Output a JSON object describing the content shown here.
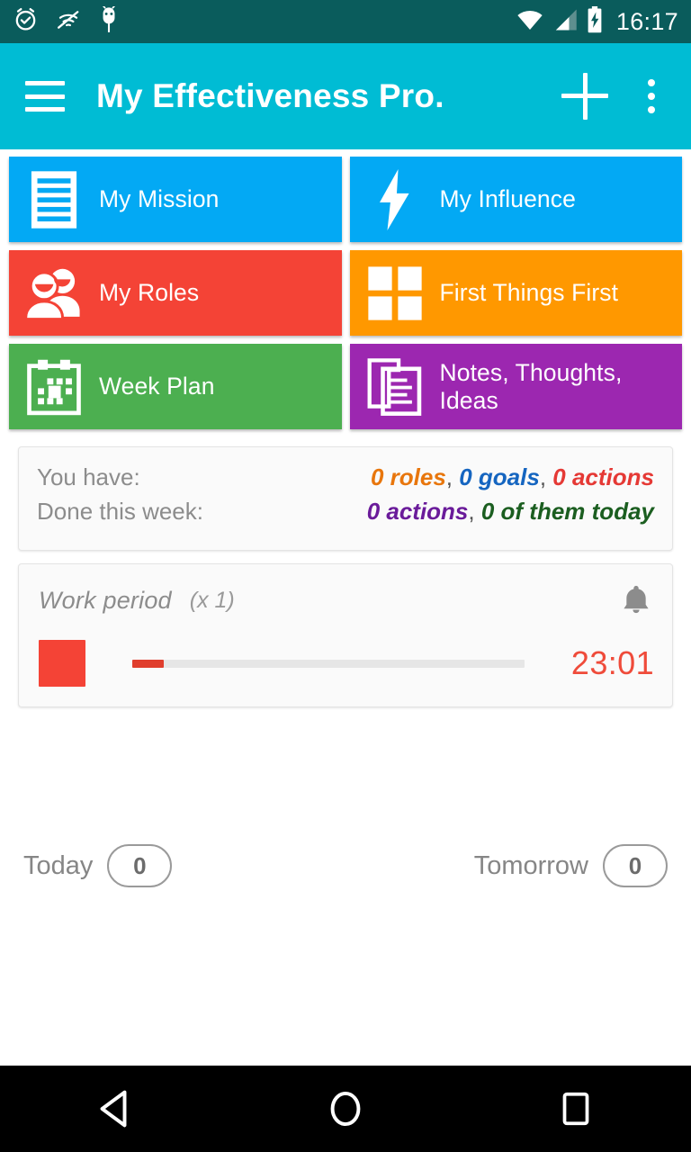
{
  "status_bar": {
    "icons": [
      "alarm-check-icon",
      "wifi-off-icon",
      "android-bug-icon"
    ],
    "signal_icon": "cell-signal-icon",
    "wifi_icon": "wifi-icon",
    "battery_icon": "battery-charging-icon",
    "clock": "16:17",
    "background_color": "#0a5c5c"
  },
  "app_bar": {
    "menu_icon": "hamburger-menu-icon",
    "title": "My Effectiveness Pro.",
    "add_icon": "plus-icon",
    "overflow_icon": "more-vertical-icon",
    "background_color": "#00bcd4"
  },
  "tiles": [
    {
      "label": "My Mission",
      "icon": "document-lines-icon",
      "color": "#03a9f4"
    },
    {
      "label": "My Influence",
      "icon": "lightning-bolt-icon",
      "color": "#03a9f4"
    },
    {
      "label": "My Roles",
      "icon": "people-group-icon",
      "color": "#f44336"
    },
    {
      "label": "First Things First",
      "icon": "quadrant-grid-icon",
      "color": "#ff9800"
    },
    {
      "label": "Week Plan",
      "icon": "calendar-icon",
      "color": "#4caf50"
    },
    {
      "label": "Notes, Thoughts, Ideas",
      "icon": "documents-stack-icon",
      "color": "#9c27b0"
    }
  ],
  "stats": {
    "have_label": "You have:",
    "have_values": [
      {
        "text": "0 roles",
        "color": "#e8760c"
      },
      {
        "text": "0 goals",
        "color": "#1565c0"
      },
      {
        "text": "0 actions",
        "color": "#e53935"
      }
    ],
    "done_label": "Done this week:",
    "done_values": [
      {
        "text": "0 actions",
        "color": "#6a1b9a"
      },
      {
        "text": "0 of them today",
        "color": "#1b5e20"
      }
    ]
  },
  "work_period": {
    "title": "Work period",
    "count": "(x 1)",
    "bell_icon": "bell-icon",
    "stop_button": "stop-button",
    "progress_percent": 8,
    "timer": "23:01",
    "timer_color": "#ef4b3a"
  },
  "day_bar": {
    "today_label": "Today",
    "today_count": "0",
    "tomorrow_label": "Tomorrow",
    "tomorrow_count": "0"
  },
  "nav_bar": {
    "back_icon": "back-triangle-icon",
    "home_icon": "home-circle-icon",
    "recents_icon": "recents-square-icon"
  }
}
